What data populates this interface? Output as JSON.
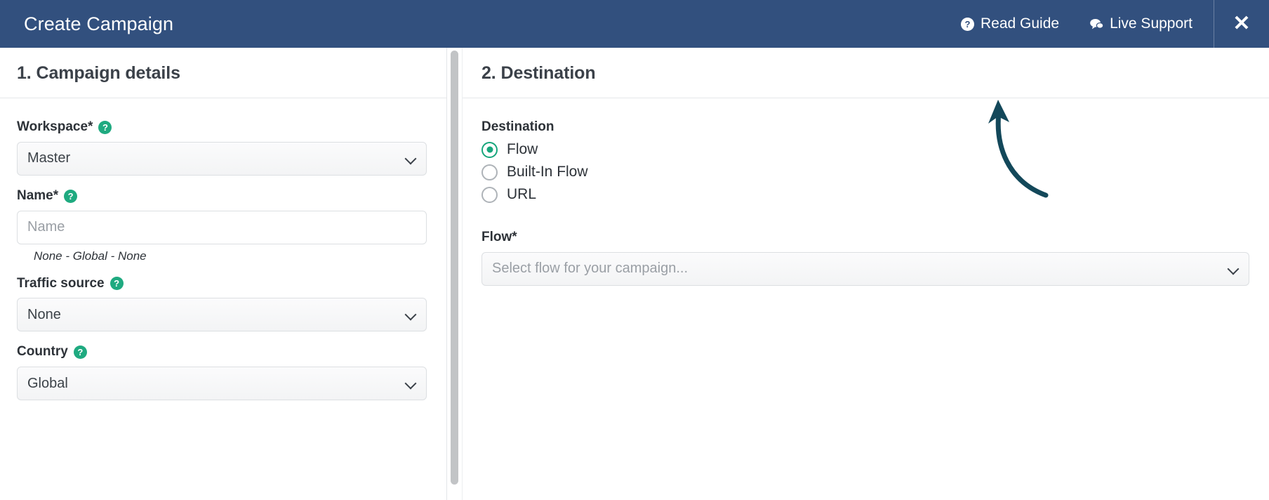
{
  "header": {
    "title": "Create Campaign",
    "links": [
      {
        "label": "Read Guide",
        "icon": "question-circle-icon"
      },
      {
        "label": "Live Support",
        "icon": "chat-bubbles-icon"
      }
    ],
    "close_label": "✕",
    "background_color": "#32507e"
  },
  "annotation": {
    "arrow_color": "#13485a",
    "points_to": "Read Guide"
  },
  "left_panel": {
    "heading": "1. Campaign details",
    "fields": {
      "workspace": {
        "label": "Workspace*",
        "help_icon": "question-circle-icon",
        "value": "Master",
        "chevron_icon": "chevron-down-icon"
      },
      "name": {
        "label": "Name*",
        "help_icon": "question-circle-icon",
        "value": "",
        "placeholder": "Name",
        "helper_text": "None - Global - None"
      },
      "traffic_source": {
        "label": "Traffic source",
        "help_icon": "question-circle-icon",
        "value": "None",
        "chevron_icon": "chevron-down-icon"
      },
      "country": {
        "label": "Country",
        "help_icon": "question-circle-icon",
        "value": "Global",
        "chevron_icon": "chevron-down-icon"
      }
    }
  },
  "right_panel": {
    "heading": "2. Destination",
    "destination": {
      "label": "Destination",
      "options": [
        {
          "label": "Flow",
          "checked": true
        },
        {
          "label": "Built-In Flow",
          "checked": false
        },
        {
          "label": "URL",
          "checked": false
        }
      ]
    },
    "flow": {
      "label": "Flow*",
      "value": "",
      "placeholder": "Select flow for your campaign...",
      "chevron_icon": "chevron-down-icon"
    }
  },
  "theme": {
    "accent_green": "#1faa80",
    "radio_checked": "#17a67c",
    "header_blue": "#32507e",
    "arrow_teal": "#13485a"
  }
}
